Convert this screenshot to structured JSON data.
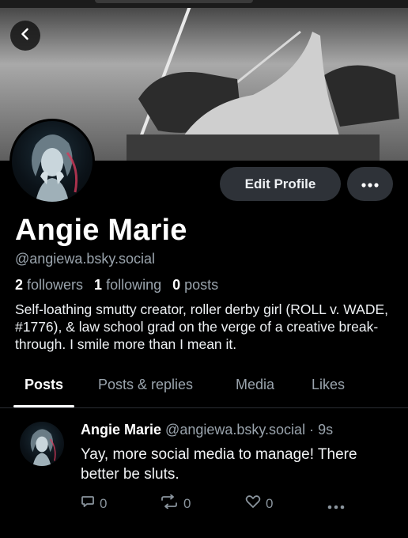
{
  "profile": {
    "display_name": "Angie Marie",
    "handle": "@angiewa.bsky.social",
    "followers_count": "2",
    "followers_label": "followers",
    "following_count": "1",
    "following_label": "following",
    "posts_count": "0",
    "posts_label": "posts",
    "bio": "Self-loathing smutty creator, roller derby girl (ROLL v. WADE, #1776), & law school grad on the verge of a creative break-through. I smile more than I mean it."
  },
  "buttons": {
    "edit_profile": "Edit Profile"
  },
  "tabs": [
    {
      "label": "Posts"
    },
    {
      "label": "Posts & replies"
    },
    {
      "label": "Media"
    },
    {
      "label": "Likes"
    }
  ],
  "post": {
    "author": "Angie Marie",
    "handle_time": "@angiewa.bsky.social · 9s",
    "text": "Yay, more social media to manage! There better be sluts.",
    "reply_count": "0",
    "repost_count": "0",
    "like_count": "0"
  },
  "icons": {
    "back": "chevron-left-icon",
    "more": "ellipsis-icon",
    "reply": "speech-bubble-icon",
    "repost": "repost-icon",
    "like": "heart-icon",
    "post_more": "ellipsis-icon"
  }
}
